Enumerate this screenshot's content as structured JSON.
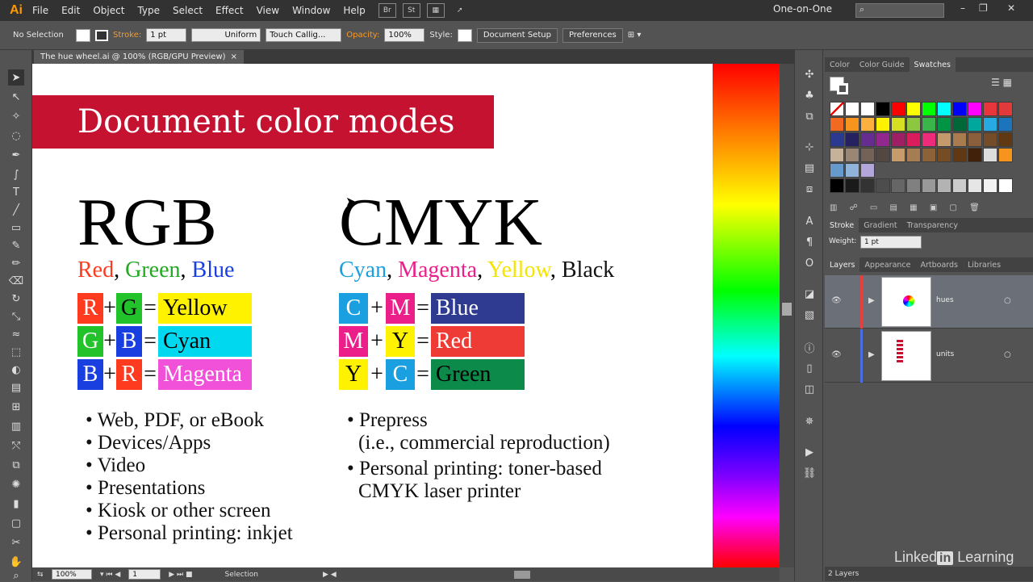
{
  "app": {
    "logo": "Ai",
    "workspace": "One-on-One"
  },
  "menu": [
    "File",
    "Edit",
    "Object",
    "Type",
    "Select",
    "Effect",
    "View",
    "Window",
    "Help"
  ],
  "menubar_icons": [
    "Br",
    "St"
  ],
  "control": {
    "selection": "No Selection",
    "stroke_label": "Stroke:",
    "stroke_value": "1 pt",
    "profile": "Uniform",
    "brush": "Touch Callig...",
    "opacity_label": "Opacity:",
    "opacity_value": "100%",
    "style_label": "Style:",
    "doc_setup": "Document Setup",
    "preferences": "Preferences"
  },
  "doc_tab": {
    "title": "The hue wheel.ai @ 100% (RGB/GPU Preview)",
    "close": "×"
  },
  "slide": {
    "title": "Document color modes",
    "rgb": {
      "heading": "RGB",
      "sub": {
        "r": "Red",
        "g": "Green",
        "b": "Blue",
        "sep": ", "
      },
      "rows": [
        {
          "a": "R",
          "b": "G",
          "res": "Yellow"
        },
        {
          "a": "G",
          "b": "B",
          "res": "Cyan"
        },
        {
          "a": "B",
          "b": "R",
          "res": "Magenta"
        }
      ],
      "bullets": [
        "Web, PDF, or eBook",
        "Devices/Apps",
        "Video",
        "Presentations",
        "Kiosk or other screen",
        "Personal printing: inkjet"
      ]
    },
    "cmyk": {
      "heading": "CMYK",
      "sub": {
        "c": "Cyan",
        "m": "Magenta",
        "y": "Yellow",
        "k": "Black",
        "sep": ", "
      },
      "rows": [
        {
          "a": "C",
          "b": "M",
          "res": "Blue"
        },
        {
          "a": "M",
          "b": "Y",
          "res": "Red"
        },
        {
          "a": "Y",
          "b": "C",
          "res": "Green"
        }
      ],
      "bullets": [
        "Prepress",
        "(i.e., commercial reproduction)",
        "Personal printing: toner-based",
        "CMYK laser printer"
      ]
    },
    "plus": "+",
    "equals": "="
  },
  "colors": {
    "title_red": "#c41230",
    "rgb_red": "#ff3b1f",
    "rgb_green": "#22c22a",
    "rgb_blue": "#1a3fe0",
    "yellow": "#fff200",
    "cyan": "#00d8f0",
    "magenta": "#f051d8",
    "cmyk_cyan": "#1aa0e0",
    "cmyk_magenta": "#ec1e8a",
    "cmyk_yellow": "#fff200",
    "cmyk_blue": "#2e3b90",
    "cmyk_red": "#ef3b36",
    "cmyk_green": "#0c8a4a"
  },
  "panels": {
    "color_tabs": [
      "Color",
      "Color Guide",
      "Swatches"
    ],
    "stroke_tabs": [
      "Stroke",
      "Gradient",
      "Transparency"
    ],
    "weight_label": "Weight:",
    "weight_value": "1 pt",
    "layer_tabs": [
      "Layers",
      "Appearance",
      "Artboards",
      "Libraries"
    ],
    "layers": [
      "hues",
      "units"
    ],
    "layer_count": "2 Layers"
  },
  "status": {
    "zoom": "100%",
    "artboard": "1",
    "tool": "Selection"
  },
  "watermark": {
    "linked": "Linked",
    "in": "in",
    "learning": "Learning"
  }
}
